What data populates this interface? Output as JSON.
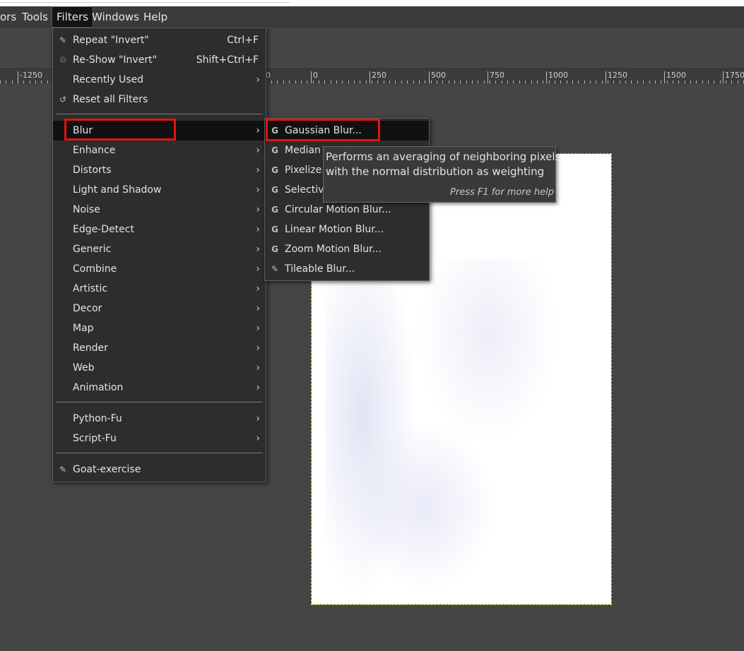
{
  "menubar": {
    "items": [
      "ors",
      "Tools",
      "Filters",
      "Windows",
      "Help"
    ]
  },
  "ruler": {
    "labels": [
      "-1250",
      "0",
      "0",
      "250",
      "500",
      "750",
      "1000",
      "1250",
      "1500",
      "1750"
    ]
  },
  "filters_menu": {
    "repeat": {
      "label": "Repeat \"Invert\"",
      "shortcut": "Ctrl+F"
    },
    "reshow": {
      "label": "Re-Show \"Invert\"",
      "shortcut": "Shift+Ctrl+F"
    },
    "recently_used": "Recently Used",
    "reset_all": "Reset all Filters",
    "categories": [
      "Blur",
      "Enhance",
      "Distorts",
      "Light and Shadow",
      "Noise",
      "Edge-Detect",
      "Generic",
      "Combine",
      "Artistic",
      "Decor",
      "Map",
      "Render",
      "Web",
      "Animation"
    ],
    "scripts": [
      "Python-Fu",
      "Script-Fu"
    ],
    "goat": "Goat-exercise",
    "arrow": "›"
  },
  "blur_menu": {
    "items": [
      {
        "label": "Gaussian Blur...",
        "icon": "gegl-icon",
        "glyph": "G"
      },
      {
        "label": "Median",
        "icon": "gegl-icon",
        "glyph": "G"
      },
      {
        "label": "Pixelize...",
        "icon": "gegl-icon",
        "glyph": "G"
      },
      {
        "label": "Selective",
        "icon": "gegl-icon",
        "glyph": "G"
      },
      {
        "label": "Circular Motion Blur...",
        "icon": "gegl-icon",
        "glyph": "G"
      },
      {
        "label": "Linear Motion Blur...",
        "icon": "gegl-icon",
        "glyph": "G"
      },
      {
        "label": "Zoom Motion Blur...",
        "icon": "gegl-icon",
        "glyph": "G"
      },
      {
        "label": "Tileable Blur...",
        "icon": "script-fu-icon",
        "glyph": "✎"
      }
    ]
  },
  "tooltip": {
    "line1": "Performs an averaging of neighboring pixels",
    "line2": "with the normal distribution as weighting",
    "hint": "Press F1 for more help"
  },
  "colors": {
    "highlight_box": "#e01414",
    "menu_bg": "#2d2d2d",
    "canvas_bg": "#454545"
  }
}
